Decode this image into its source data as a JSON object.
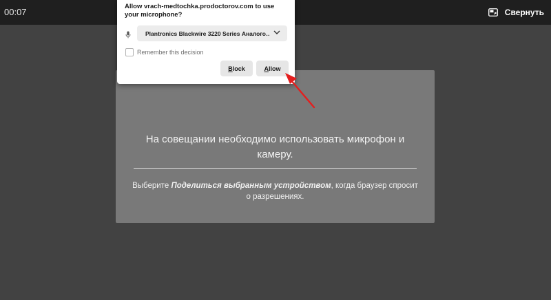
{
  "header": {
    "timer": "00:07",
    "minimize_label": "Свернуть"
  },
  "permission_popup": {
    "title": "Allow vrach-medtochka.prodoctorov.com to use your microphone?",
    "device_selected": "Plantronics Blackwire 3220 Series Аналого…",
    "remember_label": "Remember this decision",
    "remember_checked": false,
    "block_label": "Block",
    "allow_label": "Allow"
  },
  "card": {
    "message": "На совещании необходимо использовать микрофон и камеру.",
    "hint_prefix": "Выберите ",
    "hint_emphasis": "Поделиться выбранным устройством",
    "hint_suffix": ", когда браузер спросит о разрешениях."
  },
  "colors": {
    "background": "#424242",
    "topbar": "#1f1f1f",
    "card": "#797979",
    "annotation_arrow": "#e41e1e"
  },
  "icons": {
    "minimize": "picture-in-picture-icon",
    "microphone": "microphone-icon",
    "dropdown": "chevron-down-icon"
  }
}
